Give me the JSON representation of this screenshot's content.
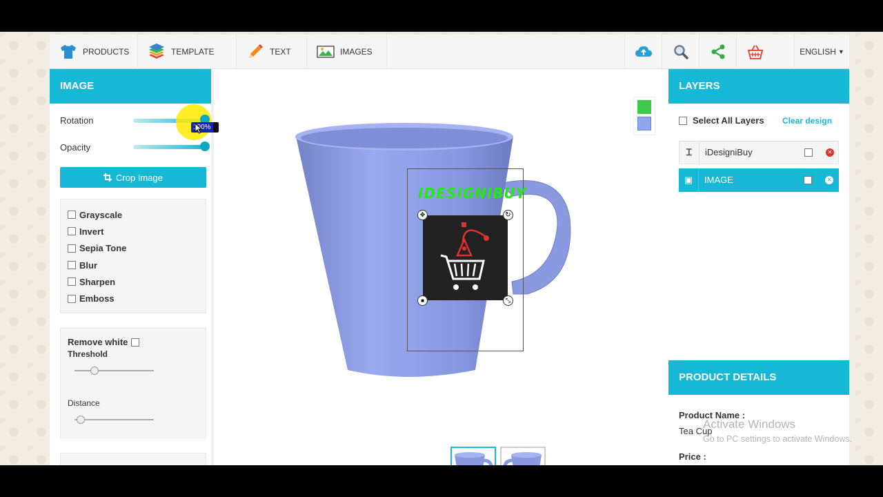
{
  "nav": {
    "products": "PRODUCTS",
    "template": "TEMPLATE",
    "text": "TEXT",
    "images": "IMAGES",
    "language": "ENGLISH"
  },
  "left_panel": {
    "title": "IMAGE",
    "rotation_label": "Rotation",
    "rotation_tooltip": "100%",
    "opacity_label": "Opacity",
    "crop_button": "Crop Image",
    "filters": [
      "Grayscale",
      "Invert",
      "Sepia Tone",
      "Blur",
      "Sharpen",
      "Emboss"
    ],
    "remove_white_label": "Remove white",
    "threshold_label": "Threshold",
    "distance_label": "Distance"
  },
  "canvas": {
    "design_text": "IDESIGNIBUY",
    "swatch_colors": [
      "#3fc94a",
      "#8fa5ef"
    ],
    "mug_color": "#8a9ae0"
  },
  "right_panel": {
    "layers_title": "LAYERS",
    "select_all": "Select All Layers",
    "clear_design": "Clear design",
    "layers": [
      {
        "name": "iDesigniBuy",
        "type": "text"
      },
      {
        "name": "IMAGE",
        "type": "image"
      }
    ],
    "product_details_title": "PRODUCT DETAILS",
    "product_name_label": "Product Name :",
    "product_name_value": "Tea Cup",
    "price_label": "Price :"
  },
  "watermark": {
    "line1": "Activate Windows",
    "line2": "Go to PC settings to activate Windows."
  },
  "colors": {
    "accent": "#16b8d5",
    "remove_icon": "#d9362b"
  }
}
